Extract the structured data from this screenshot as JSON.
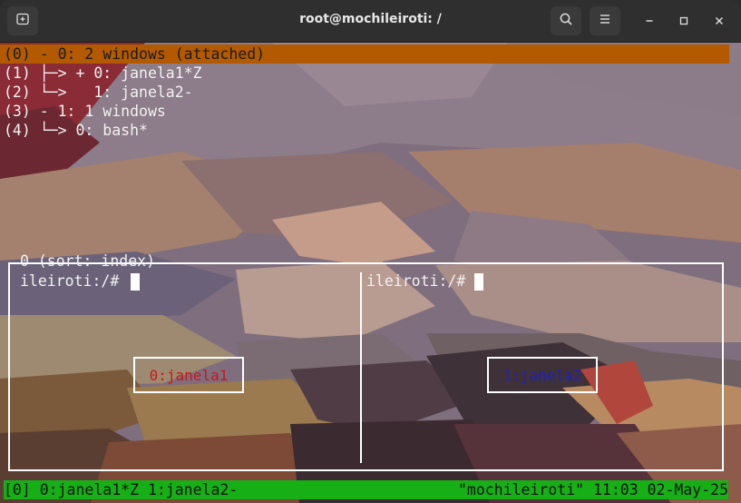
{
  "window": {
    "title": "root@mochileiroti: /"
  },
  "titlebar_icons": {
    "new_tab": "new-tab-icon",
    "search": "search-icon",
    "menu": "hamburger-menu-icon",
    "minimize": "minimize-icon",
    "maximize": "maximize-icon",
    "close": "close-icon"
  },
  "tree": {
    "items": [
      "(0) - 0: 2 windows (attached)",
      "(1) ├─> + 0: janela1*Z",
      "(2) └─>   1: janela2-",
      "(3) - 1: 1 windows",
      "(4) └─> 0: bash*"
    ]
  },
  "preview": {
    "label": "0 (sort: index)",
    "left_pane": {
      "prompt": "ileiroti:/#",
      "window_label": "0:janela1",
      "label_color": "#c81818"
    },
    "right_pane": {
      "prompt": "ileiroti:/#",
      "window_label": "1:janela2",
      "label_color": "#2020c0"
    }
  },
  "statusbar": {
    "left": "[0] 0:janela1*Z 1:janela2-",
    "right": "\"mochileiroti\" 11:03 02-May-25",
    "color": "#16b016"
  },
  "colors": {
    "highlight": "#b35a00"
  }
}
